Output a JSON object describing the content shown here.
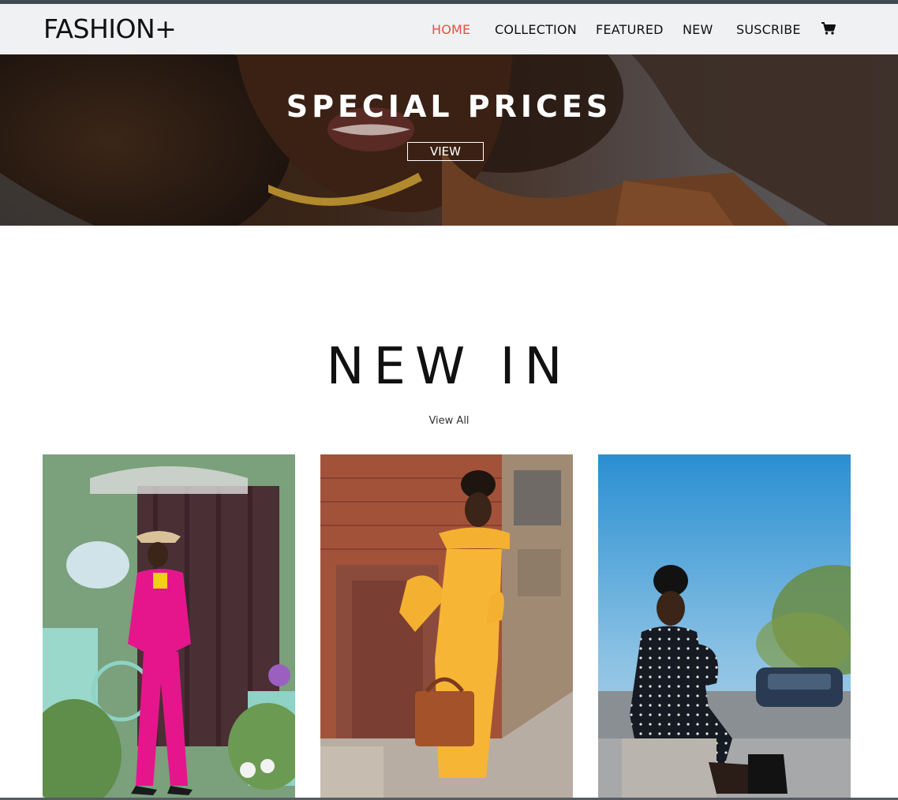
{
  "brand": {
    "name": "FASHION+"
  },
  "nav": {
    "items": [
      {
        "label": "HOME",
        "active": true
      },
      {
        "label": "COLLECTION",
        "active": false
      },
      {
        "label": "FEATURED",
        "active": false
      },
      {
        "label": "NEW",
        "active": false
      },
      {
        "label": "SUSCRIBE",
        "active": false
      }
    ],
    "cart_icon": "cart-icon"
  },
  "hero": {
    "title": "SPECIAL PRICES",
    "button_label": "VIEW"
  },
  "new_in": {
    "title": "NEW IN",
    "view_all_label": "View All",
    "products": [
      {
        "image": "woman-in-pink-suit-photo"
      },
      {
        "image": "woman-in-yellow-dress-photo"
      },
      {
        "image": "woman-in-polka-dot-dress-photo"
      }
    ]
  },
  "colors": {
    "accent": "#e8503f",
    "nav_bg": "#f0f1f3",
    "text": "#111111"
  }
}
